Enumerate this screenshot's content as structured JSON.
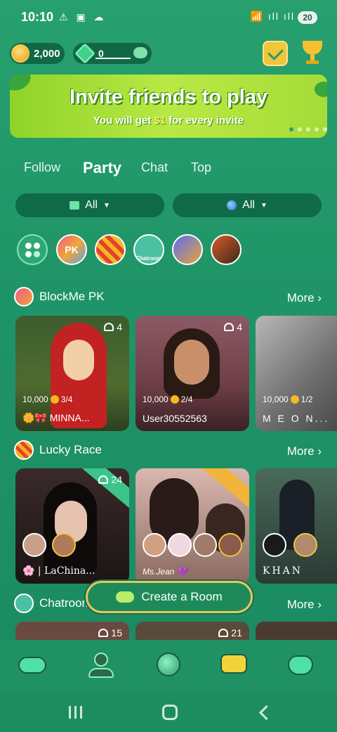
{
  "status_bar": {
    "time": "10:10",
    "left_icons": "⚠ ▣ ☁",
    "right_icons": "📶 ıll ıll",
    "battery": "20"
  },
  "top_bar": {
    "coins": "2,000",
    "gems": "0"
  },
  "banner": {
    "title": "Invite friends to play",
    "subtitle_prefix": "You will get ",
    "subtitle_amount": "$1",
    "subtitle_suffix": " for every invite"
  },
  "tabs": [
    {
      "label": "Follow"
    },
    {
      "label": "Party"
    },
    {
      "label": "Chat"
    },
    {
      "label": "Top"
    }
  ],
  "filters": [
    {
      "label": "All"
    },
    {
      "label": "All"
    }
  ],
  "game_icons": [
    "all-games-icon",
    "blockme-pk-icon",
    "lucky-race-icon",
    "chatroom-icon",
    "number-game-icon",
    "racing-game-icon"
  ],
  "game_icon_labels": {
    "pk": "PK",
    "chatroom": "Chatroom"
  },
  "sections": [
    {
      "title": "BlockMe PK",
      "more": "More",
      "cards": [
        {
          "count": "4",
          "price": "10,000",
          "seats": "3/4",
          "name": "🌼🎀 MINNA..."
        },
        {
          "count": "4",
          "price": "10,000",
          "seats": "2/4",
          "name": "User30552563"
        },
        {
          "count": "",
          "price": "10,000",
          "seats": "1/2",
          "name": "M E O N..."
        }
      ]
    },
    {
      "title": "Lucky Race",
      "more": "More",
      "cards": [
        {
          "count": "24",
          "name": "🌸 | LaChina..."
        },
        {
          "count": "",
          "name": "Ms.Jean 💜"
        },
        {
          "count": "",
          "name": "KHAN"
        }
      ]
    },
    {
      "title": "Chatroom",
      "more": "More",
      "cards": [
        {
          "count": "15"
        },
        {
          "count": "21"
        },
        {
          "count": ""
        }
      ]
    }
  ],
  "create_room": "Create a Room",
  "bottom_nav": [
    "games-icon",
    "party-icon",
    "explore-icon",
    "messages-icon",
    "profile-icon"
  ],
  "colors": {
    "bg": "#1f9468",
    "accent_gold": "#e5c760",
    "banner_green": "#b9e844"
  }
}
